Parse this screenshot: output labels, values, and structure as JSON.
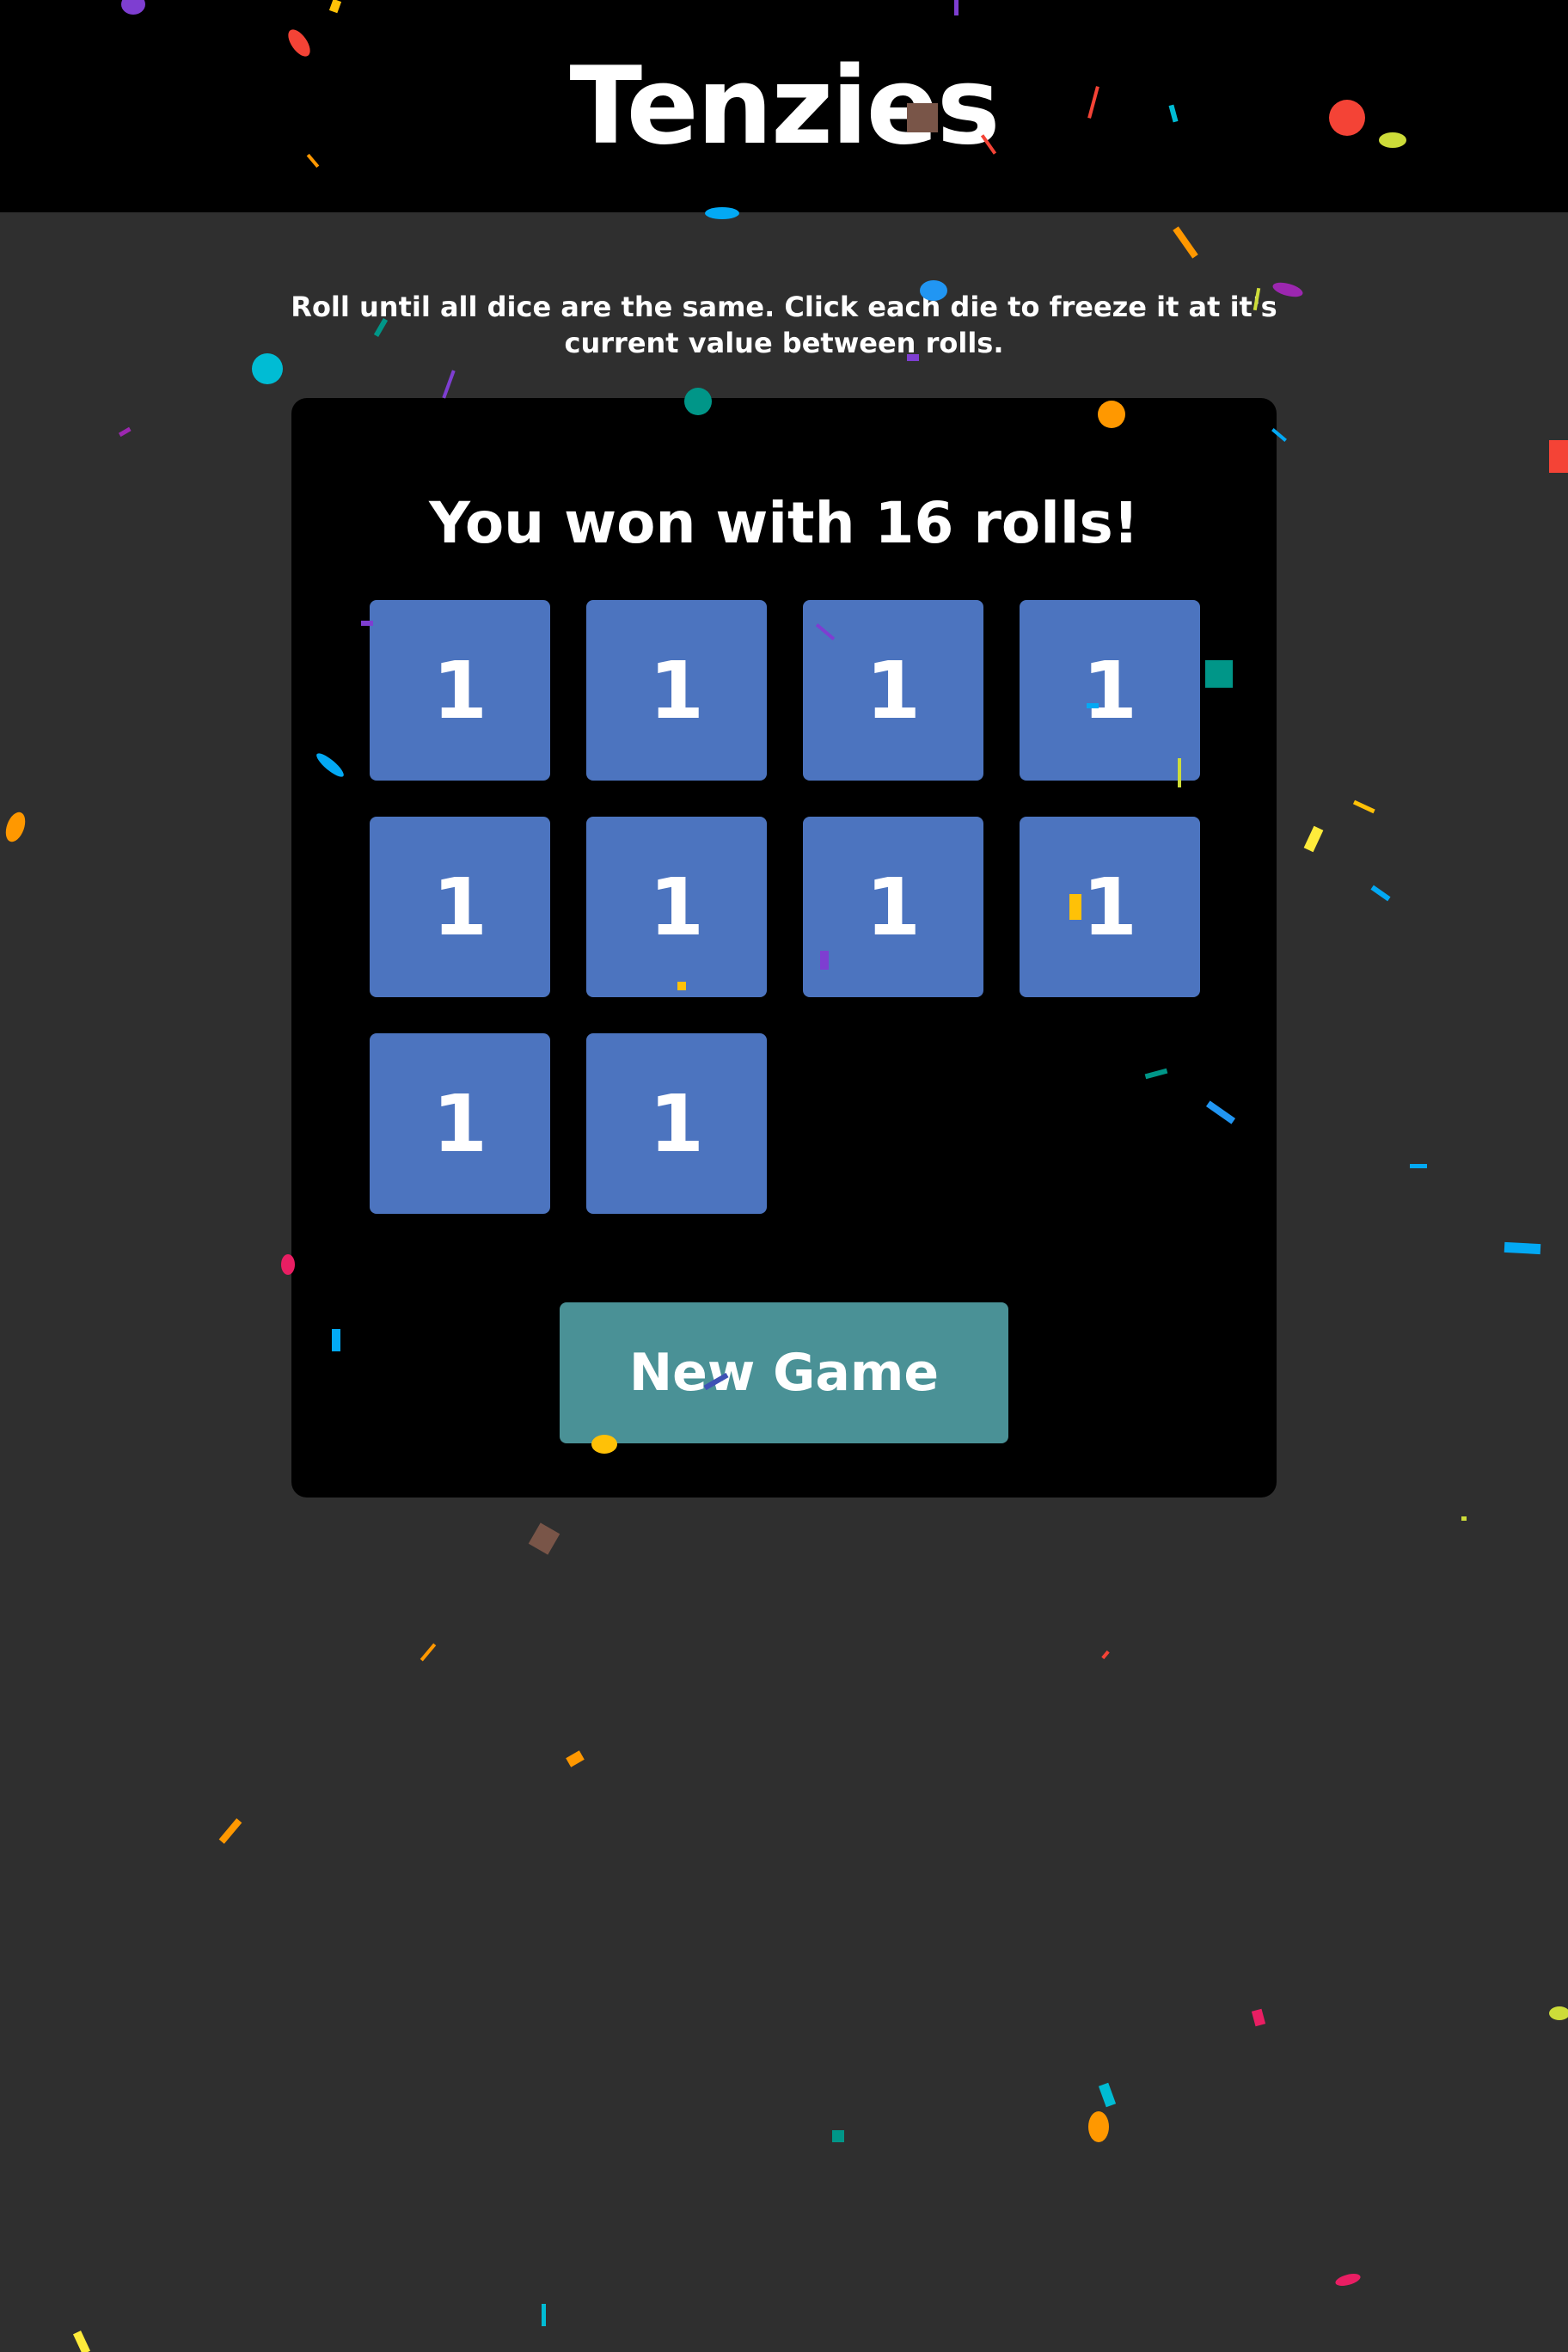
{
  "header": {
    "title": "Tenzies"
  },
  "instructions": "Roll until all dice are the same. Click each die to freeze it at it's current value between rolls.",
  "game": {
    "win_message": "You won with 16 rolls!",
    "dice": [
      {
        "value": "1"
      },
      {
        "value": "1"
      },
      {
        "value": "1"
      },
      {
        "value": "1"
      },
      {
        "value": "1"
      },
      {
        "value": "1"
      },
      {
        "value": "1"
      },
      {
        "value": "1"
      },
      {
        "value": "1"
      },
      {
        "value": "1"
      }
    ],
    "new_game_label": "New Game"
  },
  "colors": {
    "page_background": "#2f2f2f",
    "header_background": "#000000",
    "board_background": "#000000",
    "die": "#4c74bf",
    "button": "#4a9196",
    "text": "#ffffff"
  }
}
